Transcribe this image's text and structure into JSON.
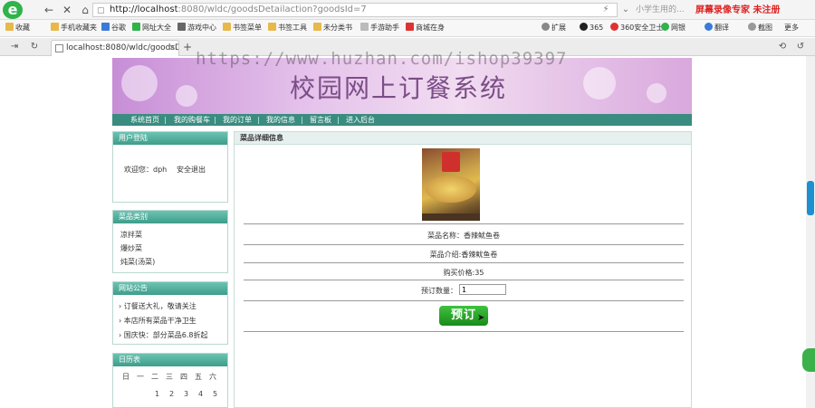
{
  "browser": {
    "logo_letter": "e",
    "back_icon": "←",
    "forward_icon": "→",
    "stop_icon": "✕",
    "home_icon": "⌂",
    "star_icon": "☆",
    "address": {
      "host": "http://localhost",
      "path": ":8080/wldc/goodsDetailaction?goodsId=7"
    },
    "search_text": "小学生用的...",
    "recorder_label": "屏幕录像专家 未注册",
    "bookmarks_left": [
      "收藏",
      "手机收藏夹",
      "谷歌",
      "网址大全",
      "游戏中心",
      "书签菜单",
      "书签工具",
      "未分类书",
      "手游助手",
      "商城在身"
    ],
    "bookmarks_right": [
      "扩展",
      "365",
      "360安全卫士",
      "网银",
      "翻译",
      "截图",
      "更多"
    ],
    "tab_title": "localhost:8080/wldc/goodsD",
    "tab_close": "×",
    "new_tab": "+"
  },
  "watermark": "https://www.huzhan.com/ishop39397",
  "site": {
    "title": "校园网上订餐系统",
    "menu": [
      "系统首页",
      "我的购餐车",
      "我的订单",
      "我的信息",
      "留言板",
      "进入后台"
    ]
  },
  "sidebar": {
    "login": {
      "heading": "用户登陆",
      "welcome": "欢迎您：dph",
      "logout": "安全退出"
    },
    "categories": {
      "heading": "菜品类别",
      "items": [
        "凉拌菜",
        "爆炒菜",
        "炖菜(汤菜)"
      ]
    },
    "notices": {
      "heading": "网站公告",
      "items": [
        "订餐送大礼，敬请关注",
        "本店所有菜品干净卫生",
        "国庆快：部分菜品6.8折起"
      ]
    },
    "calendar": {
      "heading": "日历表",
      "weekdays": [
        "日",
        "一",
        "二",
        "三",
        "四",
        "五",
        "六"
      ],
      "days": [
        "1",
        "2",
        "3",
        "4",
        "5"
      ]
    }
  },
  "detail": {
    "heading": "菜品详细信息",
    "name_line": "菜品名称：香辣鱿鱼卷",
    "intro_line": "菜品介绍:香辣鱿鱼卷",
    "price_line": "购买价格:35",
    "qty_label": "预订数量：",
    "qty_value": "1",
    "order_button": "预订"
  }
}
